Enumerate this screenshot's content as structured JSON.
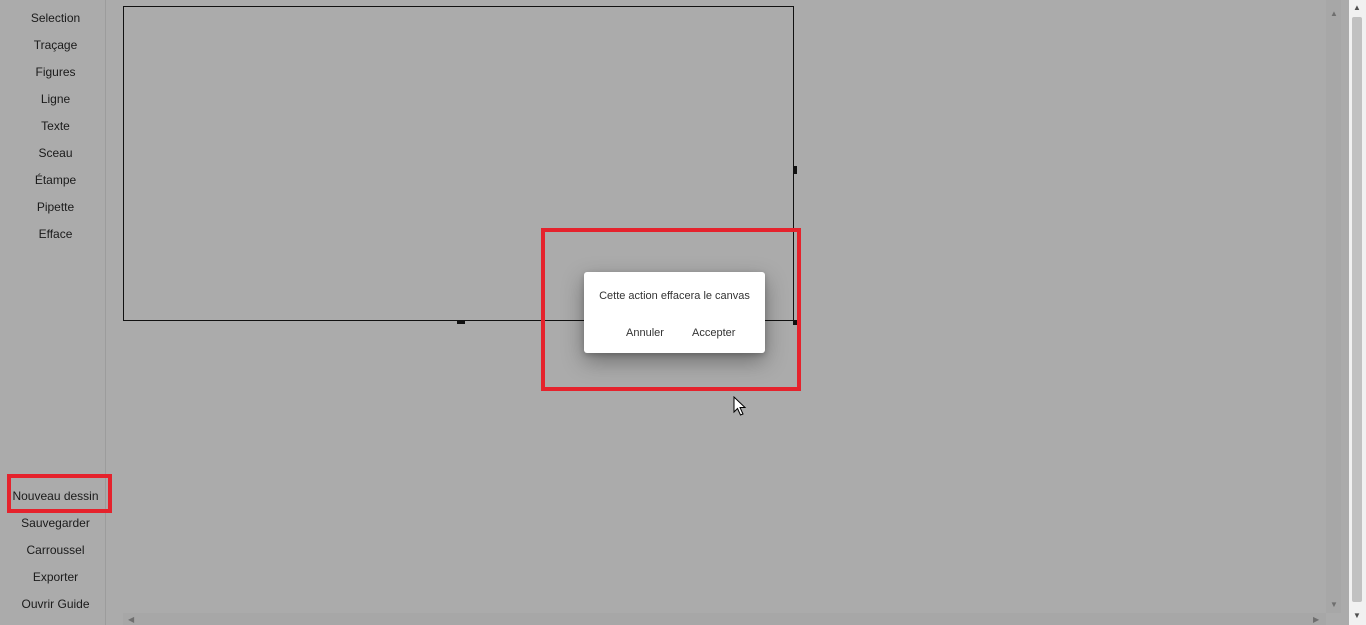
{
  "sidebar": {
    "tools": [
      {
        "label": "Selection"
      },
      {
        "label": "Traçage"
      },
      {
        "label": "Figures"
      },
      {
        "label": "Ligne"
      },
      {
        "label": "Texte"
      },
      {
        "label": "Sceau"
      },
      {
        "label": "Étampe"
      },
      {
        "label": "Pipette"
      },
      {
        "label": "Efface"
      }
    ],
    "actions": [
      {
        "label": "Nouveau dessin"
      },
      {
        "label": "Sauvegarder"
      },
      {
        "label": "Carroussel"
      },
      {
        "label": "Exporter"
      },
      {
        "label": "Ouvrir Guide"
      }
    ]
  },
  "dialog": {
    "message": "Cette action effacera le canvas",
    "cancel_label": "Annuler",
    "accept_label": "Accepter"
  },
  "colors": {
    "background": "#ababab",
    "highlight": "#e5222c",
    "dialog_bg": "#ffffff"
  },
  "icons": {
    "cursor": "mouse-pointer-icon",
    "scroll_up": "arrow-up-icon",
    "scroll_down": "arrow-down-icon",
    "scroll_left": "arrow-left-icon",
    "scroll_right": "arrow-right-icon"
  }
}
